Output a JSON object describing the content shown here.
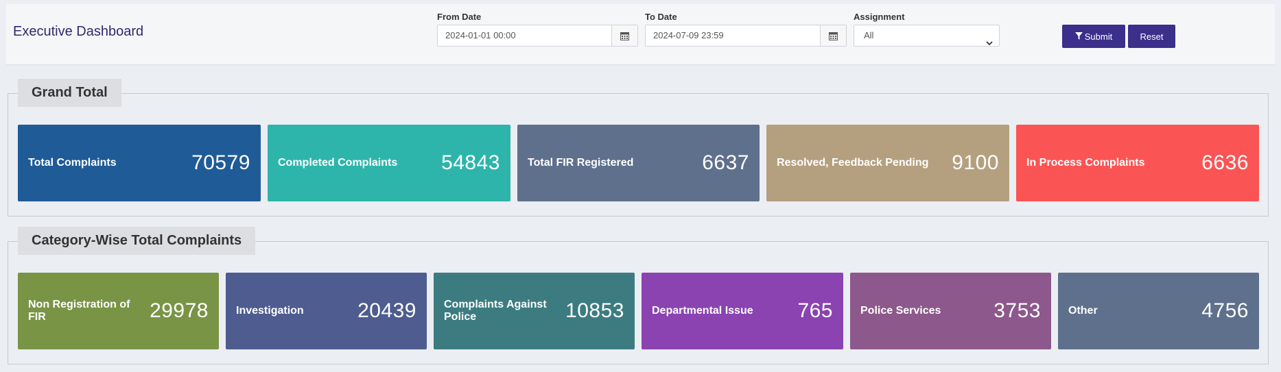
{
  "header": {
    "title": "Executive Dashboard",
    "from_date": {
      "label": "From Date",
      "value": "2024-01-01 00:00"
    },
    "to_date": {
      "label": "To Date",
      "value": "2024-07-09 23:59"
    },
    "assignment": {
      "label": "Assignment",
      "value": "All"
    },
    "submit_label": "Submit",
    "reset_label": "Reset"
  },
  "grand_total": {
    "title": "Grand Total",
    "cards": [
      {
        "label": "Total Complaints",
        "value": "70579",
        "color": "#1f5b97"
      },
      {
        "label": "Completed Complaints",
        "value": "54843",
        "color": "#2db5ab"
      },
      {
        "label": "Total FIR Registered",
        "value": "6637",
        "color": "#5e708c"
      },
      {
        "label": "Resolved, Feedback Pending",
        "value": "9100",
        "color": "#b4a07f"
      },
      {
        "label": "In Process Complaints",
        "value": "6636",
        "color": "#fb5454"
      }
    ]
  },
  "category_wise": {
    "title": "Category-Wise Total Complaints",
    "cards": [
      {
        "label": "Non Registration of FIR",
        "value": "29978",
        "color": "#7a9446"
      },
      {
        "label": "Investigation",
        "value": "20439",
        "color": "#4e5c8f"
      },
      {
        "label": "Complaints Against Police",
        "value": "10853",
        "color": "#3c7c81"
      },
      {
        "label": "Departmental Issue",
        "value": "765",
        "color": "#8a43b0"
      },
      {
        "label": "Police Services",
        "value": "3753",
        "color": "#8d588b"
      },
      {
        "label": "Other",
        "value": "4756",
        "color": "#5e708c"
      }
    ]
  }
}
